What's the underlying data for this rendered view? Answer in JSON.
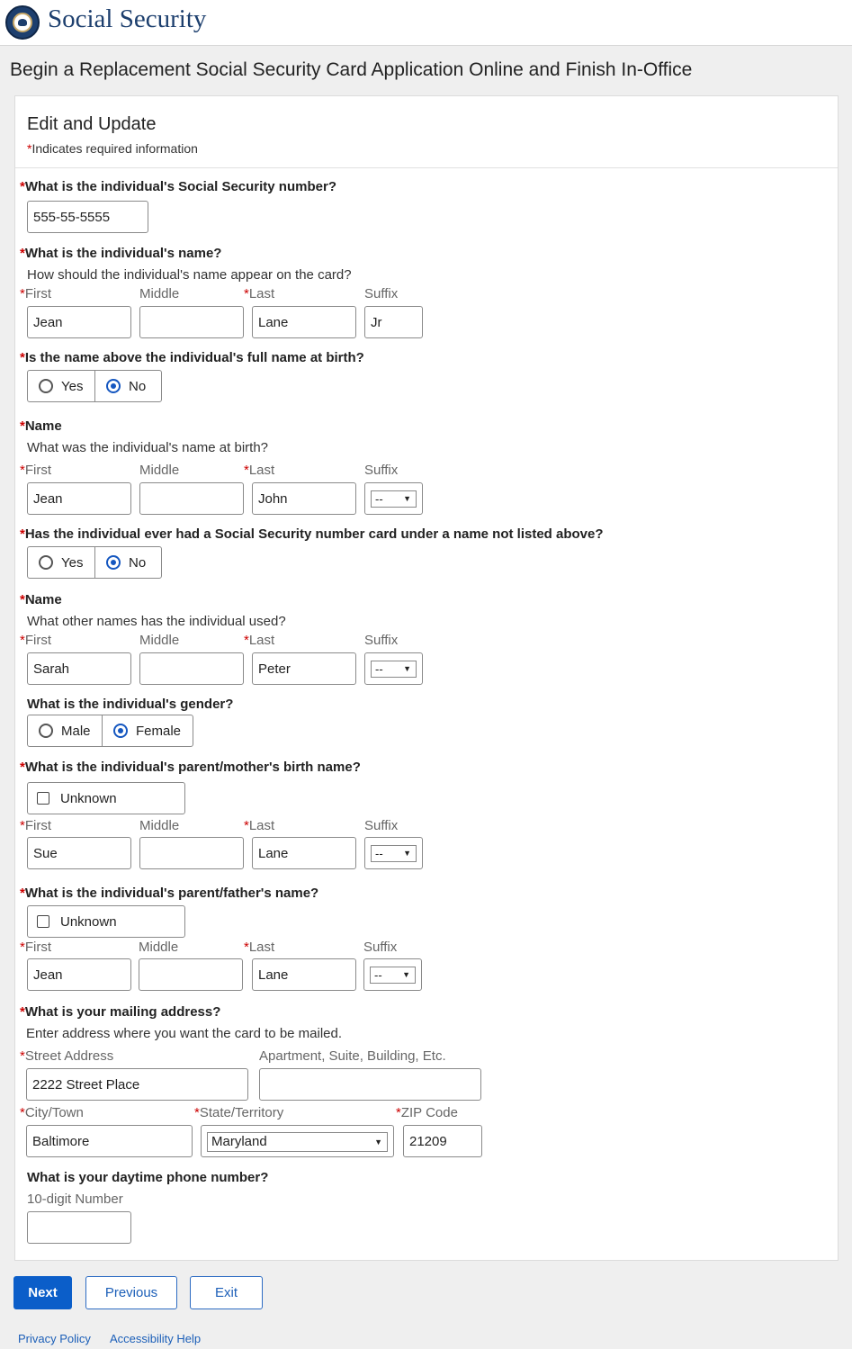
{
  "header": {
    "brand": "Social Security",
    "seal_icon": "ssa-seal-icon"
  },
  "page_title": "Begin a Replacement Social Security Card Application Online and Finish In-Office",
  "card": {
    "title": "Edit and Update",
    "required_star": "*",
    "required_note": "Indicates required information"
  },
  "labels": {
    "first": "First",
    "middle": "Middle",
    "last": "Last",
    "suffix": "Suffix",
    "yes": "Yes",
    "no": "No",
    "male": "Male",
    "female": "Female",
    "unknown": "Unknown",
    "name": "Name"
  },
  "ssn": {
    "question": "What is the individual's Social Security number?",
    "value": "555-55-5555"
  },
  "name_on_card": {
    "question": "What is the individual's name?",
    "hint": "How should the individual's name appear on the card?",
    "first": "Jean",
    "middle": "",
    "last": "Lane",
    "suffix": "Jr"
  },
  "birth_name_q": {
    "question": "Is the name above the individual's full name at birth?",
    "selected": "No"
  },
  "birth_name": {
    "hint": "What was the individual's name at birth?",
    "first": "Jean",
    "middle": "",
    "last": "John",
    "suffix": "--"
  },
  "other_card_q": {
    "question": "Has the individual ever had a Social Security number card under a name not listed above?",
    "selected": "No"
  },
  "other_name": {
    "hint": "What other names has the individual used?",
    "first": "Sarah",
    "middle": "",
    "last": "Peter",
    "suffix": "--"
  },
  "gender": {
    "question": "What is the individual's gender?",
    "selected": "Female"
  },
  "mother": {
    "question": "What is the individual's parent/mother's birth name?",
    "first": "Sue",
    "middle": "",
    "last": "Lane",
    "suffix": "--"
  },
  "father": {
    "question": "What is the individual's parent/father's name?",
    "first": "Jean",
    "middle": "",
    "last": "Lane",
    "suffix": "--"
  },
  "address": {
    "question": "What is your mailing address?",
    "hint": "Enter address where you want the card to be mailed.",
    "street_label": "Street Address",
    "street": "2222 Street Place",
    "apt_label": "Apartment, Suite, Building, Etc.",
    "apt": "",
    "city_label": "City/Town",
    "city": "Baltimore",
    "state_label": "State/Territory",
    "state": "Maryland",
    "zip_label": "ZIP Code",
    "zip": "21209"
  },
  "phone": {
    "question": "What is your daytime phone number?",
    "hint": "10-digit Number",
    "value": ""
  },
  "buttons": {
    "next": "Next",
    "previous": "Previous",
    "exit": "Exit"
  },
  "footer": {
    "privacy": "Privacy Policy",
    "accessibility": "Accessibility Help"
  },
  "colors": {
    "brand": "#1d3f6e",
    "primary": "#0b5ec9",
    "required": "#cc0000",
    "link": "#1c5fb8"
  }
}
